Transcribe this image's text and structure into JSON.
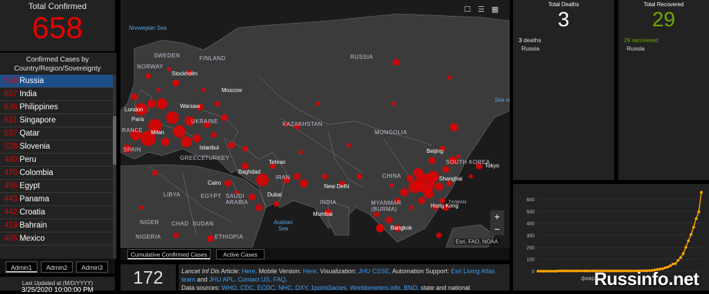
{
  "total_confirmed": {
    "label": "Total Confirmed",
    "value": "658"
  },
  "country_list": {
    "heading": "Confirmed Cases by Country/Region/Sovereignty",
    "items": [
      {
        "count": "658",
        "name": "Russia"
      },
      {
        "count": "657",
        "name": "India"
      },
      {
        "count": "636",
        "name": "Philippines"
      },
      {
        "count": "631",
        "name": "Singapore"
      },
      {
        "count": "537",
        "name": "Qatar"
      },
      {
        "count": "528",
        "name": "Slovenia"
      },
      {
        "count": "480",
        "name": "Peru"
      },
      {
        "count": "470",
        "name": "Colombia"
      },
      {
        "count": "456",
        "name": "Egypt"
      },
      {
        "count": "443",
        "name": "Panama"
      },
      {
        "count": "442",
        "name": "Croatia"
      },
      {
        "count": "419",
        "name": "Bahrain"
      },
      {
        "count": "405",
        "name": "Mexico"
      }
    ]
  },
  "admin_tabs": [
    "Admin1",
    "Admin2",
    "Admin3"
  ],
  "last_updated": {
    "label": "Last Updated at (M/D/YYYY)",
    "value": "3/25/2020 10:00:00 PM"
  },
  "map": {
    "tools": [
      "bookmark-icon",
      "list-icon",
      "qr-grid-icon"
    ],
    "labels": {
      "norwegian_sea": "Norwegian Sea",
      "sweden": "SWEDEN",
      "finland": "FINLAND",
      "norway": "NORWAY",
      "stockholm": "Stockholm",
      "russia": "RUSSIA",
      "moscow": "Moscow",
      "warsaw": "Warsaw",
      "london": "London",
      "paris": "Paris",
      "ukraine": "UKRAINE",
      "france": "RANCE",
      "milan": "Milan",
      "kazakhstan": "KAZAKHSTAN",
      "mongolia": "MONGOLIA",
      "istanbul": "Istanbul",
      "turkey": "TURKEY",
      "greece": "GREECE",
      "spain": "SPAIN",
      "baghdad": "Baghdad",
      "tehran": "Tehran",
      "iran": "IRAN",
      "china": "CHINA",
      "beijing": "Beijing",
      "korea": "SOUTH KOREA",
      "tokyo": "Tokyo",
      "sea_okho": "Sea of Okho",
      "shanghai": "Shanghai",
      "new_delhi": "New Delhi",
      "india": "INDIA",
      "cairo": "Cairo",
      "libya": "LIBYA",
      "egypt": "EGYPT",
      "saudi": "SAUDI ARABIA",
      "dubai": "Dubai",
      "myanmar": "MYANMAR (BURMA)",
      "hong_kong": "Hong Kong",
      "arabian_sea": "Arabian Sea",
      "mumbai": "Mumbai",
      "bangkok": "Bangkok",
      "niger": "NIGER",
      "chad": "CHAD",
      "sudan": "SUDAN",
      "nigeria": "NIGERIA",
      "ethiopia": "ETHIOPIA",
      "taiwan": "TAIWAN"
    },
    "zoom_in": "+",
    "zoom_out": "−",
    "attribution": "Esri, FAO, NOAA"
  },
  "map_tabs": [
    "Cumulative Confirmed Cases",
    "Active Cases"
  ],
  "country_count": "172",
  "info": {
    "lancet_prefix": "Lancet Inf Dis",
    "article": " Article: ",
    "here1": "Here",
    "mobile": ". Mobile Version: ",
    "here2": "Here",
    "visualization": ". Visualization: ",
    "jhu": "JHU CSSE",
    "automation": ". Automation Support: ",
    "esri": "Esri Living Atlas team",
    "and": " and ",
    "jhu_apl": "JHU APL",
    "sep1": ". ",
    "contact": "Contact US",
    "sep2": ". ",
    "faq": "FAQ",
    "end1": ".",
    "data_sources": "Data sources: ",
    "sources": "WHO, CDC, ECDC, NHC, DXY, 1point3acres, Worldometers.info, BNO,",
    "tail": " state and national"
  },
  "deaths": {
    "label": "Total Deaths",
    "value": "3",
    "line1_num": "3",
    "line1_text": " deaths",
    "line2": "Russia"
  },
  "recovered": {
    "label": "Total Recovered",
    "value": "29",
    "line1_num": "29",
    "line1_text": " recovered",
    "line2": "Russia"
  },
  "colors": {
    "confirmed": "#e60000",
    "recovered": "#70a800",
    "line": "#ffa500",
    "link": "#3aa0ff"
  },
  "watermark": "Russinfo.net",
  "chart_data": {
    "type": "line",
    "title": "",
    "xlabel": "",
    "ylabel": "",
    "ylim": [
      0,
      600
    ],
    "yticks": [
      0,
      100,
      200,
      300,
      400,
      500,
      600
    ],
    "x_tick_label": "февр",
    "series": [
      {
        "values": [
          0,
          0,
          0,
          0,
          0,
          0,
          0,
          0,
          2,
          2,
          2,
          2,
          2,
          2,
          2,
          2,
          2,
          2,
          2,
          2,
          2,
          2,
          2,
          2,
          2,
          2,
          2,
          2,
          2,
          2,
          2,
          2,
          2,
          2,
          2,
          2,
          2,
          2,
          2,
          2,
          3,
          3,
          3,
          4,
          6,
          10,
          14,
          17,
          20,
          28,
          34,
          45,
          59,
          63,
          90,
          114,
          147,
          199,
          253,
          306,
          367,
          438,
          495,
          658
        ]
      }
    ]
  }
}
